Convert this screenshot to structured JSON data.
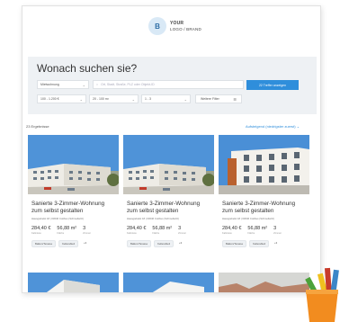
{
  "brand": {
    "initial": "B",
    "line1": "YOUR",
    "line2": "LOGO / BRAND"
  },
  "search": {
    "title": "Wonach suchen sie?",
    "type_value": "Mietwohnung",
    "location_placeholder": "Ort, Stadt, Straße, PLZ oder Objekt-ID",
    "price_value": "100 - 1.200 €",
    "area_value": "20 - 100 m²",
    "rooms_value": "1 - 3",
    "more_filter_label": "Weitere Filter",
    "submit_label": "22 Treffer anzeigen"
  },
  "results": {
    "count_label": "23 Ergebnisse",
    "sort_label": "Aufsteigend (niedrigster zuerst)"
  },
  "listings": [
    {
      "title": "Sanierte 3-Zimmer-Wohnung zum selbst gestalten",
      "address": "Hausgiebelst 18 | 03046 Cottbus (Schmellwitz)",
      "price": "284,40 €",
      "price_label": "Kaltmiete",
      "area": "56,88 m²",
      "area_label": "Fläche",
      "rooms": "3",
      "rooms_label": "Zimmer",
      "tags": [
        "Balkon/Terasse",
        "Kellerabteil",
        "+3"
      ]
    },
    {
      "title": "Sanierte 3-Zimmer-Wohnung zum selbst gestalten",
      "address": "Hausgiebelst 18 | 03046 Cottbus (Schmellwitz)",
      "price": "284,40 €",
      "price_label": "Kaltmiete",
      "area": "56,88 m²",
      "area_label": "Fläche",
      "rooms": "3",
      "rooms_label": "Zimmer",
      "tags": [
        "Balkon/Terasse",
        "Kellerabteil",
        "+3"
      ]
    },
    {
      "title": "Sanierte 3-Zimmer-Wohnung zum selbst gestalten",
      "address": "Hausgiebelst 18 | 03046 Cottbus (Schmellwitz)",
      "price": "284,40 €",
      "price_label": "Kaltmiete",
      "area": "56,88 m²",
      "area_label": "Fläche",
      "rooms": "3",
      "rooms_label": "Zimmer",
      "tags": [
        "Balkon/Terasse",
        "Kellerabteil",
        "+3"
      ]
    }
  ],
  "colors": {
    "accent": "#2f8edb",
    "hero_bg": "#eef1f4",
    "sky": "#4d8fd5"
  }
}
